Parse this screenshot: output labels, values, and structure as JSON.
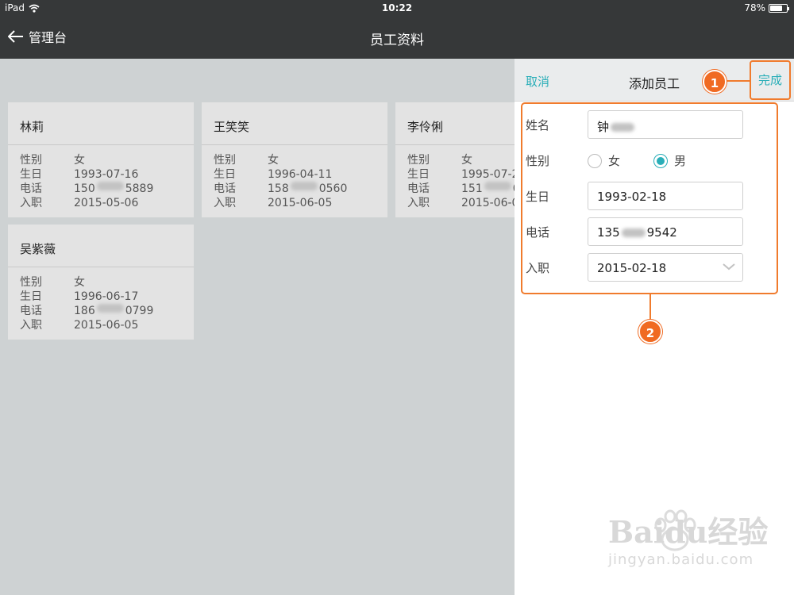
{
  "status": {
    "device": "iPad",
    "time": "10:22",
    "battery": "78%",
    "battery_level": 0.78
  },
  "nav": {
    "back_label": "管理台",
    "title": "员工资料"
  },
  "labels": {
    "gender": "性别",
    "birthday": "生日",
    "phone": "电话",
    "hired": "入职"
  },
  "employees": [
    {
      "name": "林莉",
      "gender": "女",
      "birthday": "1993-07-16",
      "phone_prefix": "150",
      "phone_suffix": "5889",
      "hired": "2015-05-06"
    },
    {
      "name": "王笑笑",
      "gender": "女",
      "birthday": "1996-04-11",
      "phone_prefix": "158",
      "phone_suffix": "0560",
      "hired": "2015-06-05"
    },
    {
      "name": "李伶俐",
      "gender": "女",
      "birthday": "1995-07-2",
      "phone_prefix": "151",
      "phone_suffix": "0",
      "hired": "2015-06-0"
    },
    {
      "name": "吴紫薇",
      "gender": "女",
      "birthday": "1996-06-17",
      "phone_prefix": "186",
      "phone_suffix": "0799",
      "hired": "2015-06-05"
    }
  ],
  "panel": {
    "cancel_label": "取消",
    "title": "添加员工",
    "done_label": "完成",
    "form": {
      "name_label": "姓名",
      "name_value": "钟",
      "gender_label": "性别",
      "gender_female": "女",
      "gender_male": "男",
      "gender_selected": "男",
      "birthday_label": "生日",
      "birthday_value": "1993-02-18",
      "phone_label": "电话",
      "phone_prefix": "135",
      "phone_suffix": "9542",
      "hired_label": "入职",
      "hired_value": "2015-02-18"
    }
  },
  "annotations": {
    "badge1": "1",
    "badge2": "2",
    "color": "#f07b2d"
  },
  "accent_color": "#2aaeb8",
  "watermark": {
    "brand": "Baidu经验",
    "url": "jingyan.baidu.com"
  }
}
